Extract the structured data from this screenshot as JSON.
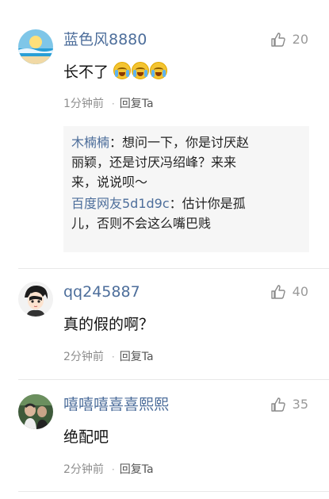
{
  "comments": [
    {
      "username": "蓝色风8880",
      "likes": "20",
      "content": "长不了",
      "emojis": [
        "crying-laughing-emoji",
        "crying-laughing-emoji",
        "crying-laughing-emoji"
      ],
      "time": "1分钟前",
      "separator": "·",
      "reply_label": "回复Ta",
      "quote": [
        {
          "name": "木楠楠",
          "line1": "：想问一下，你是讨厌赵",
          "line2": "丽颖，还是讨厌冯绍峰？来来",
          "line3": "来，说说呗～"
        },
        {
          "name": "百度网友5d1d9c",
          "line1": "：估计你是孤",
          "line2": "儿，否则不会这么嘴巴贱"
        }
      ]
    },
    {
      "username": "qq245887",
      "likes": "40",
      "content": "真的假的啊？",
      "time": "2分钟前",
      "separator": "·",
      "reply_label": "回复Ta"
    },
    {
      "username": "嘻嘻嘻喜喜熙熙",
      "likes": "35",
      "content": "绝配吧",
      "time": "2分钟前",
      "separator": "·",
      "reply_label": "回复Ta"
    }
  ]
}
